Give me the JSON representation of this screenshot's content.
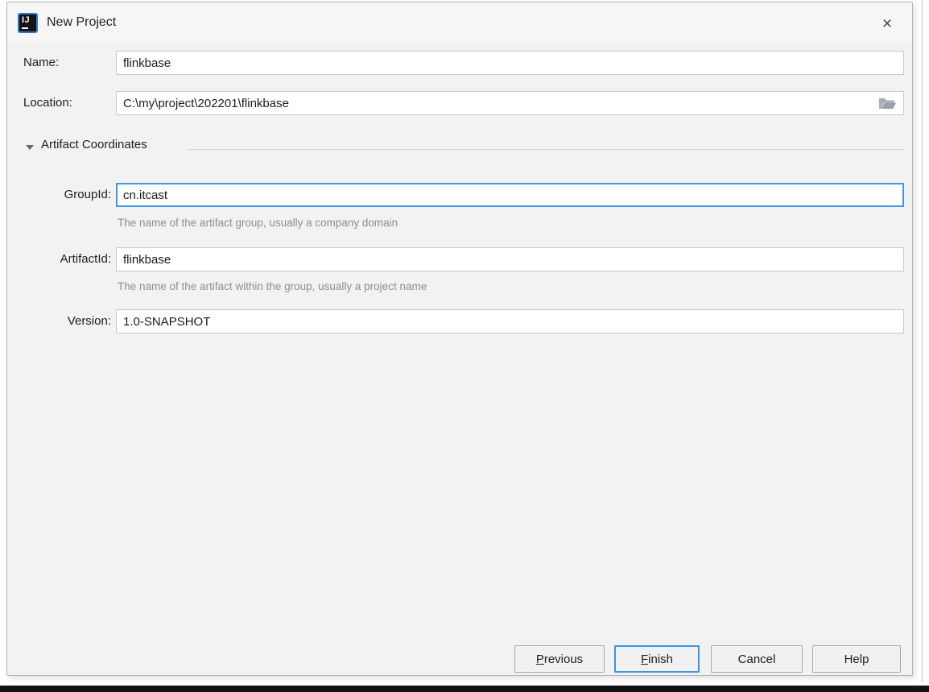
{
  "window": {
    "title": "New Project",
    "app_icon_text": "IJ",
    "close_glyph": "×"
  },
  "form": {
    "name": {
      "label": "Name:",
      "value": "flinkbase"
    },
    "location": {
      "label": "Location:",
      "value": "C:\\my\\project\\202201\\flinkbase"
    },
    "section": {
      "title": "Artifact Coordinates",
      "expanded": true
    },
    "group_id": {
      "label": "GroupId:",
      "value": "cn.itcast",
      "hint": "The name of the artifact group, usually a company domain",
      "focused": true
    },
    "artifact_id": {
      "label": "ArtifactId:",
      "value": "flinkbase",
      "hint": "The name of the artifact within the group, usually a project name"
    },
    "version": {
      "label": "Version:",
      "value": "1.0-SNAPSHOT"
    }
  },
  "buttons": {
    "previous": {
      "mnemonic": "P",
      "rest": "revious"
    },
    "finish": {
      "mnemonic": "F",
      "rest": "inish"
    },
    "cancel": {
      "label": "Cancel"
    },
    "help": {
      "label": "Help"
    }
  },
  "icons": {
    "app": "intellij-idea-logo",
    "browse": "open-folder",
    "close": "close-x",
    "section_toggle": "chevron-down"
  },
  "colors": {
    "dialog_bg": "#f2f2f2",
    "focus_border": "#3c99e8",
    "default_button_border": "#3a97e4",
    "hint_text": "#8e8e8e",
    "field_border": "#c8c8c8",
    "bottom_strip": "#131313"
  }
}
